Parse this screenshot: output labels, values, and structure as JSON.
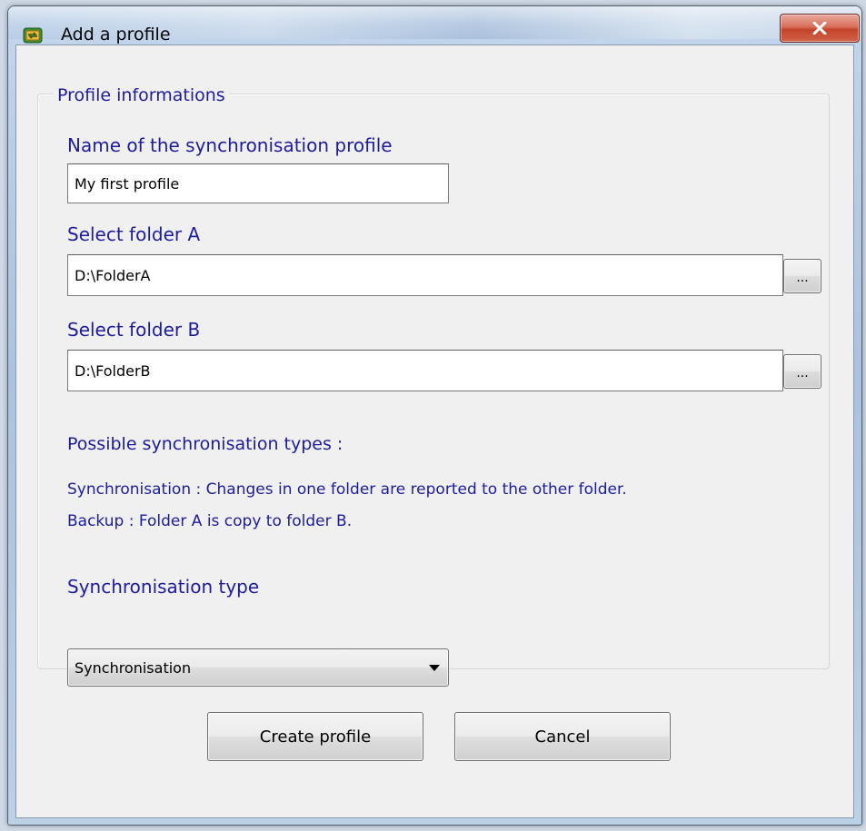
{
  "window": {
    "title": "Add a profile",
    "app_icon": "sync-profile-icon",
    "close_icon": "close-icon"
  },
  "group": {
    "legend": "Profile informations"
  },
  "profile_name": {
    "label": "Name of the synchronisation profile",
    "value": "My first profile"
  },
  "folder_a": {
    "label": "Select folder A",
    "value": "D:\\FolderA",
    "browse_label": "..."
  },
  "folder_b": {
    "label": "Select folder B",
    "value": "D:\\FolderB",
    "browse_label": "..."
  },
  "sync_types": {
    "heading": "Possible synchronisation types :",
    "lines": [
      "Synchronisation : Changes in one folder are reported to the other folder.",
      "Backup : Folder A is copy to folder B."
    ]
  },
  "sync_type_select": {
    "label": "Synchronisation type",
    "selected": "Synchronisation"
  },
  "buttons": {
    "create": "Create profile",
    "cancel": "Cancel"
  },
  "colors": {
    "label_text": "#1d1d9c",
    "dialog_background": "#f0f0f0",
    "close_button": "#c4442b"
  }
}
